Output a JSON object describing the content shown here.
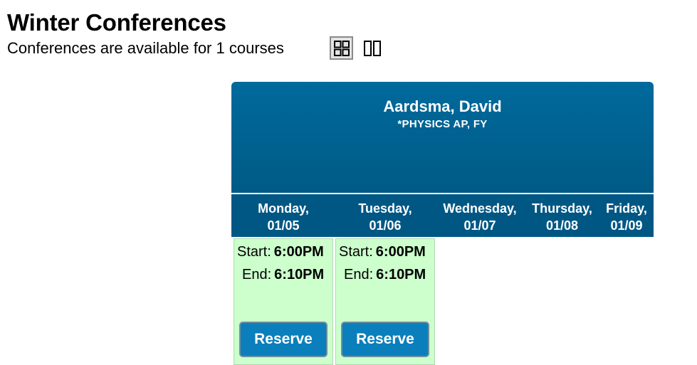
{
  "page": {
    "title": "Winter Conferences",
    "subtitle": "Conferences are available for 1 courses"
  },
  "view_toggle": {
    "grid_icon": "grid-view-icon",
    "columns_icon": "column-view-icon"
  },
  "card": {
    "teacher": "Aardsma, David",
    "course": "*PHYSICS AP, FY",
    "days": [
      {
        "day": "Monday,",
        "date": "01/05"
      },
      {
        "day": "Tuesday,",
        "date": "01/06"
      },
      {
        "day": "Wednesday,",
        "date": "01/07"
      },
      {
        "day": "Thursday,",
        "date": "01/08"
      },
      {
        "day": "Friday,",
        "date": "01/09"
      }
    ],
    "slots": [
      {
        "start_label": "Start:",
        "start": "6:00PM",
        "end_label": "End:",
        "end": "6:10PM",
        "button": "Reserve"
      },
      {
        "start_label": "Start:",
        "start": "6:00PM",
        "end_label": "End:",
        "end": "6:10PM",
        "button": "Reserve"
      }
    ]
  },
  "colors": {
    "header_top": "#006a9c",
    "header_bottom": "#005a86",
    "day_strip": "#005784",
    "slot_bg": "#ccffcc",
    "button_bg": "#0a7fbc"
  }
}
